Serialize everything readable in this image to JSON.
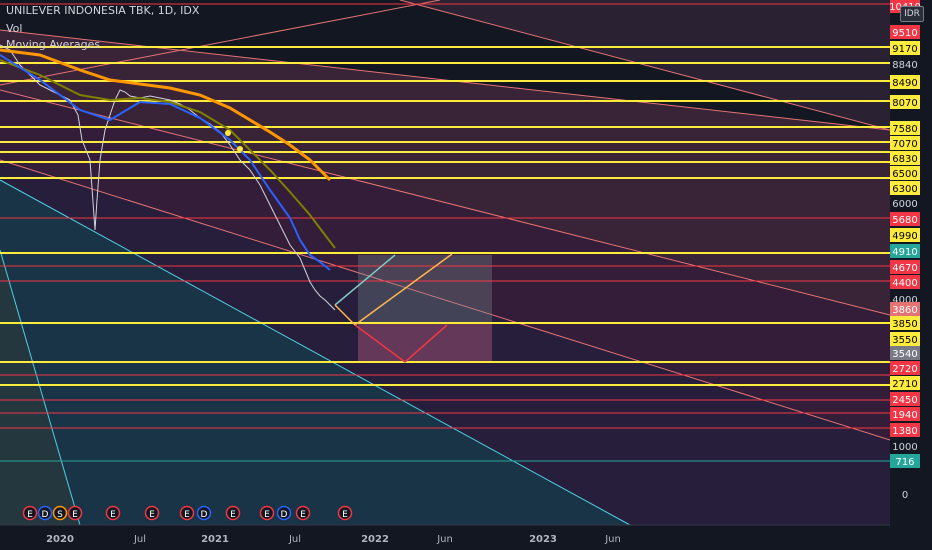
{
  "header": {
    "symbol_line": "UNILEVER INDONESIA TBK, 1D, IDX",
    "vol": "Vol",
    "ma": "Moving Averages"
  },
  "currency": "IDR",
  "colors": {
    "background": "#131722",
    "yellow": "#ffeb3b",
    "red": "#f23645",
    "teal": "#26a69a",
    "orange": "#ff9800",
    "blue": "#2962ff",
    "olive": "#808000"
  },
  "chart_data": {
    "type": "line",
    "x_ticks": [
      "2020",
      "Jul",
      "2021",
      "Jul",
      "2022",
      "Jun",
      "2023",
      "Jun"
    ],
    "y_ticks": [
      "10410",
      "9510",
      "9170",
      "8840",
      "8490",
      "8070",
      "7580",
      "7070",
      "6830",
      "6500",
      "6300",
      "6000",
      "5680",
      "4990",
      "4910",
      "4670",
      "4400",
      "4000",
      "3860",
      "3850",
      "3550",
      "3540",
      "2720",
      "2710",
      "2450",
      "1940",
      "1380",
      "1000",
      "716",
      "0"
    ],
    "horizontal_levels": [
      {
        "value": 9510,
        "color": "#f23645"
      },
      {
        "value": 9170,
        "color": "#ffeb3b"
      },
      {
        "value": 8840,
        "color": "#ffeb3b"
      },
      {
        "value": 8490,
        "color": "#ffeb3b"
      },
      {
        "value": 8070,
        "color": "#ffeb3b"
      },
      {
        "value": 7580,
        "color": "#ffeb3b"
      },
      {
        "value": 7070,
        "color": "#ffeb3b"
      },
      {
        "value": 6830,
        "color": "#ffeb3b"
      },
      {
        "value": 6500,
        "color": "#ffeb3b"
      },
      {
        "value": 6300,
        "color": "#ffeb3b"
      },
      {
        "value": 5680,
        "color": "#f23645"
      },
      {
        "value": 4990,
        "color": "#ffeb3b"
      },
      {
        "value": 4670,
        "color": "#f23645"
      },
      {
        "value": 4400,
        "color": "#f23645"
      },
      {
        "value": 3850,
        "color": "#ffeb3b"
      },
      {
        "value": 3550,
        "color": "#ffeb3b"
      },
      {
        "value": 2720,
        "color": "#f23645"
      },
      {
        "value": 2710,
        "color": "#ffeb3b"
      },
      {
        "value": 2450,
        "color": "#f23645"
      },
      {
        "value": 1940,
        "color": "#f23645"
      },
      {
        "value": 1380,
        "color": "#f23645"
      },
      {
        "value": 716,
        "color": "#26a69a"
      }
    ],
    "price_tags": [
      {
        "label": "10410",
        "bg": "#f23645",
        "fg": "#ffffff"
      },
      {
        "label": "9510",
        "bg": "#f23645",
        "fg": "#ffffff"
      },
      {
        "label": "9170",
        "bg": "#ffeb3b",
        "fg": "#000000"
      },
      {
        "label": "8840",
        "bg": "#131722",
        "fg": "#d1d4dc"
      },
      {
        "label": "8490",
        "bg": "#ffeb3b",
        "fg": "#000000"
      },
      {
        "label": "8070",
        "bg": "#ffeb3b",
        "fg": "#000000"
      },
      {
        "label": "7580",
        "bg": "#ffeb3b",
        "fg": "#000000"
      },
      {
        "label": "7070",
        "bg": "#ffeb3b",
        "fg": "#000000"
      },
      {
        "label": "6830",
        "bg": "#ffeb3b",
        "fg": "#000000"
      },
      {
        "label": "6500",
        "bg": "#ffeb3b",
        "fg": "#000000"
      },
      {
        "label": "6300",
        "bg": "#ffeb3b",
        "fg": "#000000"
      },
      {
        "label": "6000",
        "bg": "#131722",
        "fg": "#d1d4dc"
      },
      {
        "label": "5680",
        "bg": "#f23645",
        "fg": "#ffffff"
      },
      {
        "label": "4990",
        "bg": "#ffeb3b",
        "fg": "#000000"
      },
      {
        "label": "4910",
        "bg": "#26a69a",
        "fg": "#ffffff"
      },
      {
        "label": "4670",
        "bg": "#f23645",
        "fg": "#ffffff"
      },
      {
        "label": "4400",
        "bg": "#f23645",
        "fg": "#ffffff"
      },
      {
        "label": "4000",
        "bg": "#131722",
        "fg": "#d1d4dc"
      },
      {
        "label": "3860",
        "bg": "#e57373",
        "fg": "#ffffff"
      },
      {
        "label": "3850",
        "bg": "#ffeb3b",
        "fg": "#000000"
      },
      {
        "label": "3550",
        "bg": "#ffeb3b",
        "fg": "#000000"
      },
      {
        "label": "3540",
        "bg": "#787b86",
        "fg": "#ffffff"
      },
      {
        "label": "2720",
        "bg": "#f23645",
        "fg": "#ffffff"
      },
      {
        "label": "2710",
        "bg": "#ffeb3b",
        "fg": "#000000"
      },
      {
        "label": "2450",
        "bg": "#f23645",
        "fg": "#ffffff"
      },
      {
        "label": "1940",
        "bg": "#f23645",
        "fg": "#ffffff"
      },
      {
        "label": "1380",
        "bg": "#f23645",
        "fg": "#ffffff"
      },
      {
        "label": "1000",
        "bg": "#131722",
        "fg": "#d1d4dc"
      },
      {
        "label": "716",
        "bg": "#26a69a",
        "fg": "#ffffff"
      },
      {
        "label": "0",
        "bg": "#131722",
        "fg": "#d1d4dc"
      }
    ],
    "event_markers": [
      "E",
      "D",
      "S",
      "E",
      "E",
      "E",
      "E",
      "D",
      "E",
      "E",
      "D",
      "E",
      "E",
      "E"
    ],
    "grid": true,
    "legend": "top-left"
  }
}
